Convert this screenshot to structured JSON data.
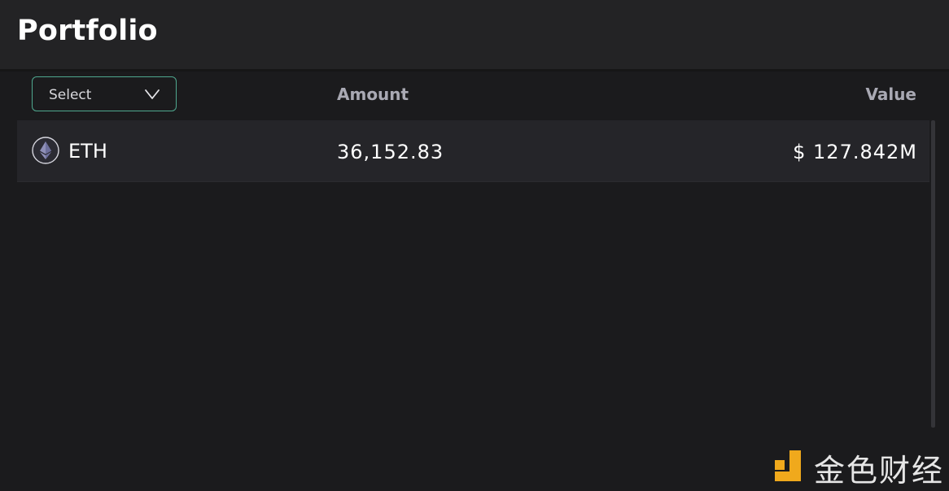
{
  "header": {
    "title": "Portfolio"
  },
  "filter": {
    "select_label": "Select",
    "icon": "chevron-down-icon"
  },
  "table": {
    "columns": [
      "Amount",
      "Value"
    ],
    "rows": [
      {
        "icon": "eth-icon",
        "symbol": "ETH",
        "amount": "36,152.83",
        "value": "$ 127.842M"
      }
    ]
  },
  "watermark": {
    "text": "金色财经",
    "icon": "jinse-logo-icon"
  },
  "colors": {
    "background": "#1b1b1d",
    "header_bg": "#232325",
    "row_bg": "#252529",
    "select_border": "#4fa88f",
    "header_text": "#a9a9b3",
    "watermark_logo": "#f0a91c"
  }
}
